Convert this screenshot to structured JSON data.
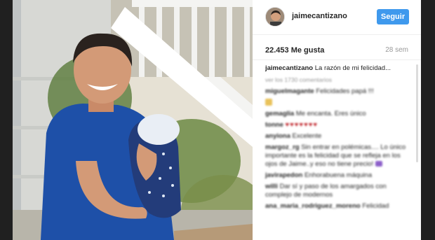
{
  "post": {
    "username": "jaimecantizano",
    "follow_label": "Seguir",
    "likes": "22.453 Me gusta",
    "age": "28 sem",
    "caption_user": "jaimecantizano",
    "caption_text": "La razón de mi felicidad...",
    "load_more": "ver los 1730 comentarios"
  },
  "comments": [
    {
      "user": "miguelmagante",
      "text": "Felicidades papá !!!"
    },
    {
      "user": "",
      "text": "",
      "emoji": "folded-hands"
    },
    {
      "user": "gemaglia",
      "text": "Me encanta. Eres único"
    },
    {
      "user": "tonne",
      "text": "",
      "emoji": "hearts"
    },
    {
      "user": "anyiona",
      "text": "Excelente"
    },
    {
      "user": "margoz_rg",
      "text": "Sin entrar en polémicas.... Lo único importante es la felicidad que se refleja en los ojos de Jaime..y eso no tiene precio!",
      "emoji": "purple"
    },
    {
      "user": "javirapedon",
      "text": "Enhorabuena máquina"
    },
    {
      "user": "willi",
      "text": "Dar sí y paso de los amargados con complejo de modernos"
    },
    {
      "user": "ana_maria_rodriguez_moreno",
      "text": "Felicidad"
    }
  ],
  "colors": {
    "follow_button": "#3f99ed",
    "heart": "#c1272d"
  }
}
